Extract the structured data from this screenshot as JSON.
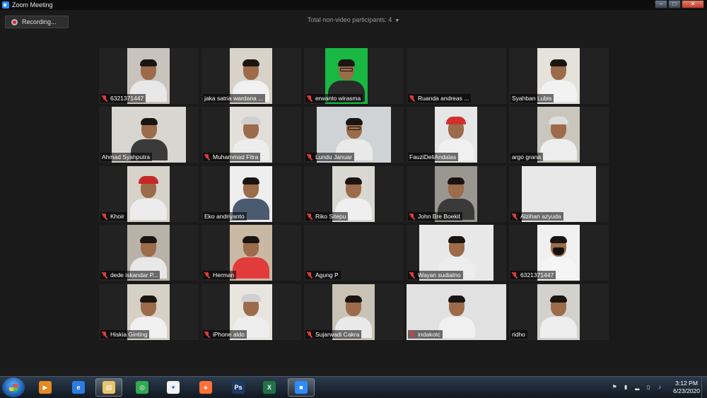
{
  "window": {
    "title": "Zoom Meeting"
  },
  "recording": {
    "label": "Recording..."
  },
  "nonvideo": {
    "label": "Total non-video participants: 4"
  },
  "participants": [
    {
      "name": "6321371447",
      "muted": true,
      "bg": "#c8c3bd",
      "body": "#e8e8e8",
      "cap": ""
    },
    {
      "name": "jaka satria wardana ...",
      "muted": false,
      "bg": "#d8d2c8",
      "body": "#f1f1f1",
      "cap": ""
    },
    {
      "name": "erwanto wirasma",
      "muted": true,
      "bg": "#18b842",
      "body": "#2a2a2a",
      "cap": ""
    },
    {
      "name": "Ruanda andreas ...",
      "muted": true,
      "bg": "",
      "body": "",
      "cap": ""
    },
    {
      "name": "Syahban Lubis",
      "muted": false,
      "bg": "#e5e2dc",
      "body": "#f2f2f2",
      "cap": ""
    },
    {
      "name": "Ahmad Syahputra",
      "muted": false,
      "bg": "#d8d6d0",
      "body": "#3a3a3a",
      "cap": ""
    },
    {
      "name": "Muhammad Fitra",
      "muted": true,
      "bg": "#e2dfda",
      "body": "#ededed",
      "cap": "#cfcfcf"
    },
    {
      "name": "Lundu Januar",
      "muted": true,
      "bg": "#cfd3d6",
      "body": "#e9e9e9",
      "cap": ""
    },
    {
      "name": "FauziDeliAndalas",
      "muted": false,
      "bg": "#e6e6e6",
      "body": "#f0f0f0",
      "cap": "#d32f2f"
    },
    {
      "name": "argo grana",
      "muted": false,
      "bg": "#c9c6bd",
      "body": "#eeeeee",
      "cap": "#dddddd"
    },
    {
      "name": "Khoir",
      "muted": true,
      "bg": "#d7d2ca",
      "body": "#ececec",
      "cap": "#c62828"
    },
    {
      "name": "Eko andriyanto",
      "muted": false,
      "bg": "#eeeeee",
      "body": "#4a5b70",
      "cap": ""
    },
    {
      "name": "Riko Sitepu",
      "muted": true,
      "bg": "#d9d7d1",
      "body": "#efefef",
      "cap": ""
    },
    {
      "name": "John Bre Boekit",
      "muted": true,
      "bg": "#9a9690",
      "body": "#3a3a3a",
      "cap": ""
    },
    {
      "name": "Alzihan azyuda",
      "muted": true,
      "bg": "#e8e8e8",
      "body": "",
      "cap": ""
    },
    {
      "name": "dede iskandar P...",
      "muted": true,
      "bg": "#b9b2a8",
      "body": "#e8e8e8",
      "cap": ""
    },
    {
      "name": "Herman",
      "muted": true,
      "bg": "#c9b9a4",
      "body": "#e23b3b",
      "cap": ""
    },
    {
      "name": "Agung P",
      "muted": true,
      "bg": "",
      "body": "",
      "cap": ""
    },
    {
      "name": "Wayan sudiatno",
      "muted": true,
      "bg": "#e8e8e8",
      "body": "#ededed",
      "cap": ""
    },
    {
      "name": "6321371447",
      "muted": true,
      "bg": "#f0f0f0",
      "body": "#f5f5f5",
      "cap": ""
    },
    {
      "name": "Hiskia Ginting",
      "muted": true,
      "bg": "#d6d0c5",
      "body": "#f0f0f0",
      "cap": ""
    },
    {
      "name": "iPhone aldo",
      "muted": true,
      "bg": "#e8e4de",
      "body": "#ededed",
      "cap": "#d0d0d0"
    },
    {
      "name": "Sujarwadi Cakra",
      "muted": true,
      "bg": "#c9c3b6",
      "body": "#e9e9e9",
      "cap": ""
    },
    {
      "name": "indakotc",
      "muted": true,
      "bg": "#e1e1e1",
      "body": "#f0f0f0",
      "cap": ""
    },
    {
      "name": "ridho",
      "muted": false,
      "bg": "#d3d1cc",
      "body": "#eeeeee",
      "cap": ""
    }
  ],
  "taskbar": {
    "apps": [
      {
        "name": "media-player",
        "color": "#e58a1f",
        "glyph": "▶"
      },
      {
        "name": "internet-explorer",
        "color": "#2a7de1",
        "glyph": "e"
      },
      {
        "name": "file-explorer",
        "color": "#e8c56a",
        "glyph": "▤"
      },
      {
        "name": "chrome",
        "color": "#34a853",
        "glyph": "◎"
      },
      {
        "name": "app-blue-white",
        "color": "#f2f2f2",
        "glyph": "✦"
      },
      {
        "name": "firefox",
        "color": "#ff7139",
        "glyph": "●"
      },
      {
        "name": "photoshop",
        "color": "#1c3a63",
        "glyph": "Ps"
      },
      {
        "name": "excel",
        "color": "#217346",
        "glyph": "X"
      },
      {
        "name": "zoom",
        "color": "#2d8cff",
        "glyph": "■"
      }
    ],
    "time": "3:12 PM",
    "date": "6/23/2020"
  }
}
